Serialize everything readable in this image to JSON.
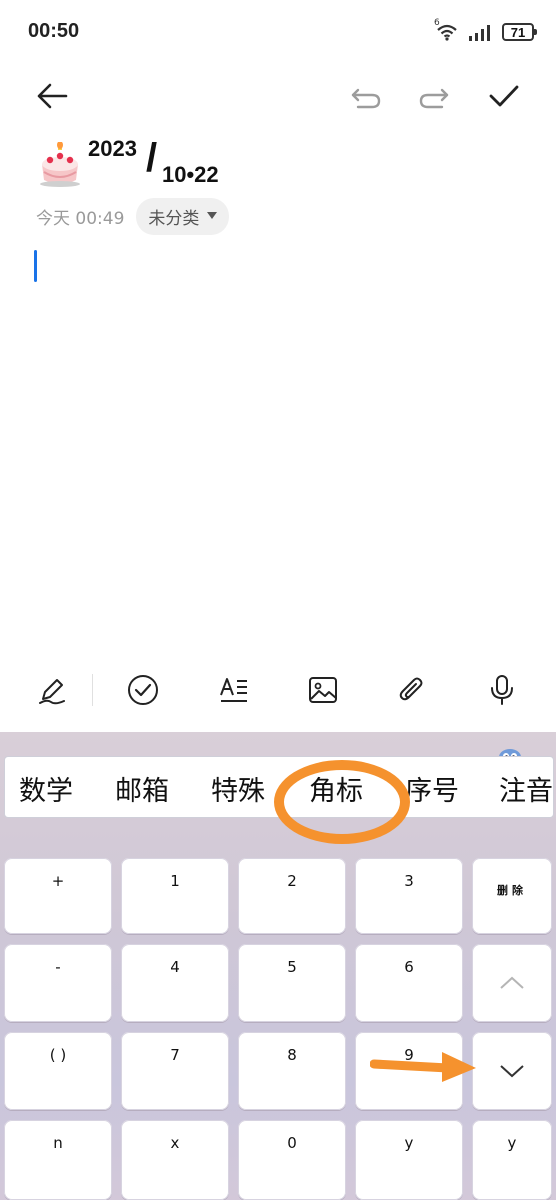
{
  "status_bar": {
    "time": "00:50",
    "network_label": "6",
    "battery_level": "71"
  },
  "note": {
    "title_year": "2023",
    "title_slash": "/",
    "title_date": "10•22",
    "timestamp": "今天 00:49",
    "category": "未分类"
  },
  "toolbar_icons": [
    "back-arrow-icon",
    "undo-icon",
    "redo-icon",
    "check-icon"
  ],
  "format_icons": [
    "pen-icon",
    "checklist-icon",
    "text-format-icon",
    "image-icon",
    "attachment-icon",
    "microphone-icon"
  ],
  "keyboard": {
    "symbol_categories": [
      "数学",
      "邮箱",
      "特殊",
      "角标",
      "序号",
      "注音"
    ],
    "selected_category": "角标",
    "keys": [
      [
        "+",
        "1",
        "2",
        "3",
        "删除"
      ],
      [
        "-",
        "4",
        "5",
        "6",
        "up"
      ],
      [
        "( )",
        "7",
        "8",
        "9",
        "down"
      ],
      [
        "n",
        "x",
        "0",
        "y",
        "y"
      ]
    ],
    "delete_label": "删除"
  },
  "colors": {
    "accent_caret": "#1a73e8",
    "annotation": "#f5922e"
  }
}
